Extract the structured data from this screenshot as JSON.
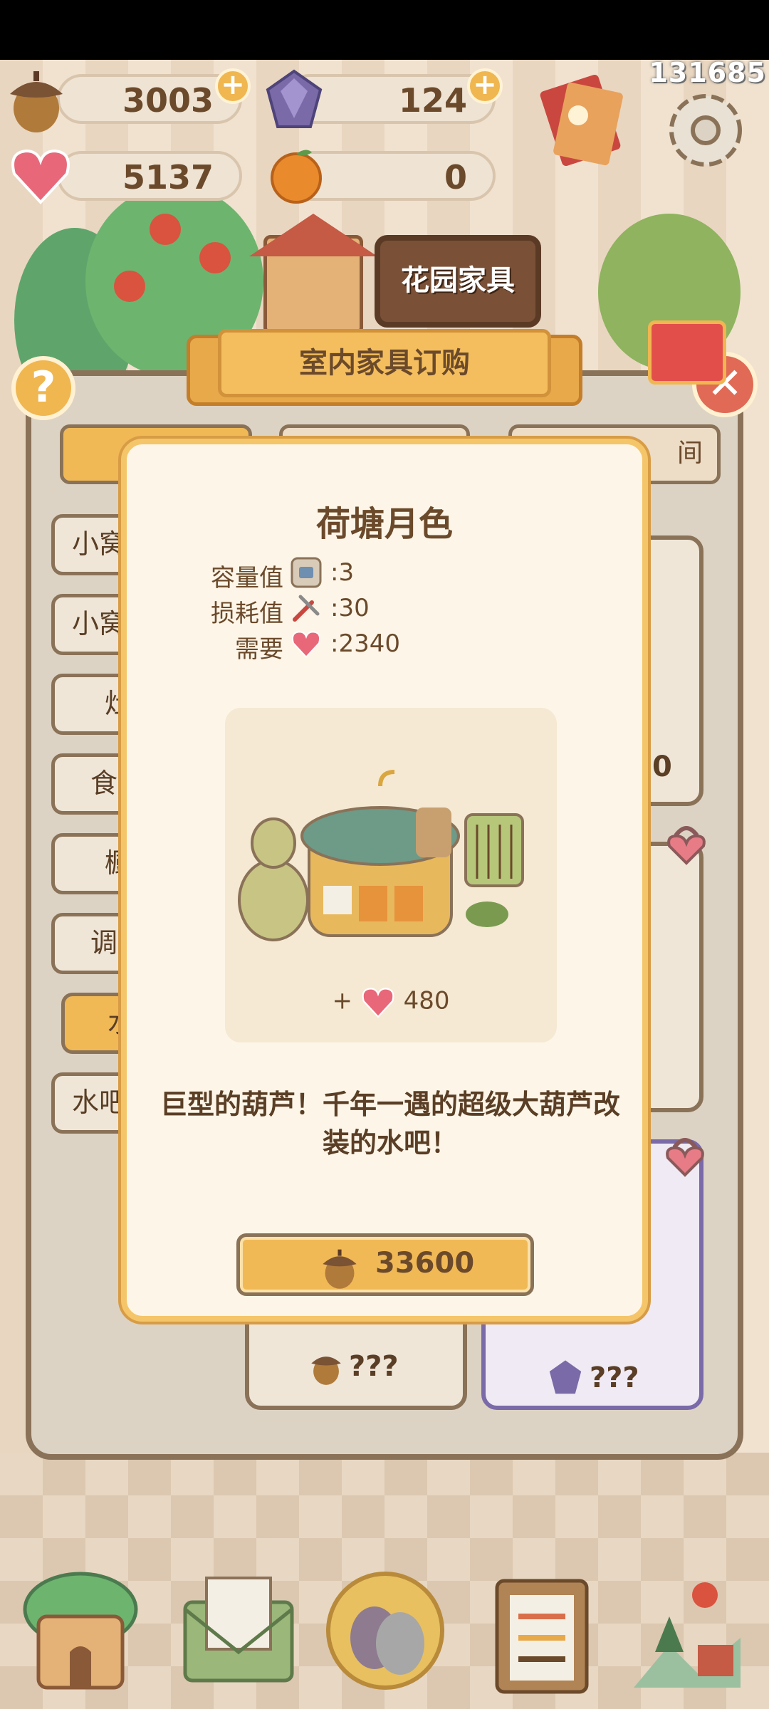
{
  "hud": {
    "uid": "131685",
    "acorns": "3003",
    "gems": "124",
    "hearts": "5137",
    "oranges": "0"
  },
  "panel": {
    "title": "室内家具订购",
    "garden_tab": "花园家具",
    "top_tab_right_partial": "间",
    "side_items": [
      "小窝",
      "小窝",
      "灶",
      "食",
      "橱",
      "调",
      "水",
      "水吧"
    ],
    "card_price_unknown": "???",
    "partial_card_value": "0"
  },
  "dialog": {
    "title": "荷塘月色",
    "capacity_label": "容量值",
    "capacity_value": ":3",
    "wear_label": "损耗值",
    "wear_value": ":30",
    "need_label": "需要",
    "need_value": ":2340",
    "bonus_prefix": "+",
    "bonus_value": "480",
    "description": "巨型的葫芦！千年一遇的超级大葫芦改装的水吧！",
    "price": "33600"
  },
  "colors": {
    "accent": "#f1b956",
    "panel_border": "#8a7258",
    "close_red": "#e06a55",
    "dialog_bg": "#fdf6e8"
  },
  "icons": [
    "acorn-icon",
    "gem-icon",
    "heart-crystal-icon",
    "orange-icon",
    "gear-icon",
    "envelope-icon",
    "help-icon",
    "close-icon",
    "lock-icon",
    "capacity-icon",
    "wrench-icon",
    "home-nav-icon",
    "mail-nav-icon",
    "friends-nav-icon",
    "tasks-nav-icon",
    "map-nav-icon"
  ]
}
